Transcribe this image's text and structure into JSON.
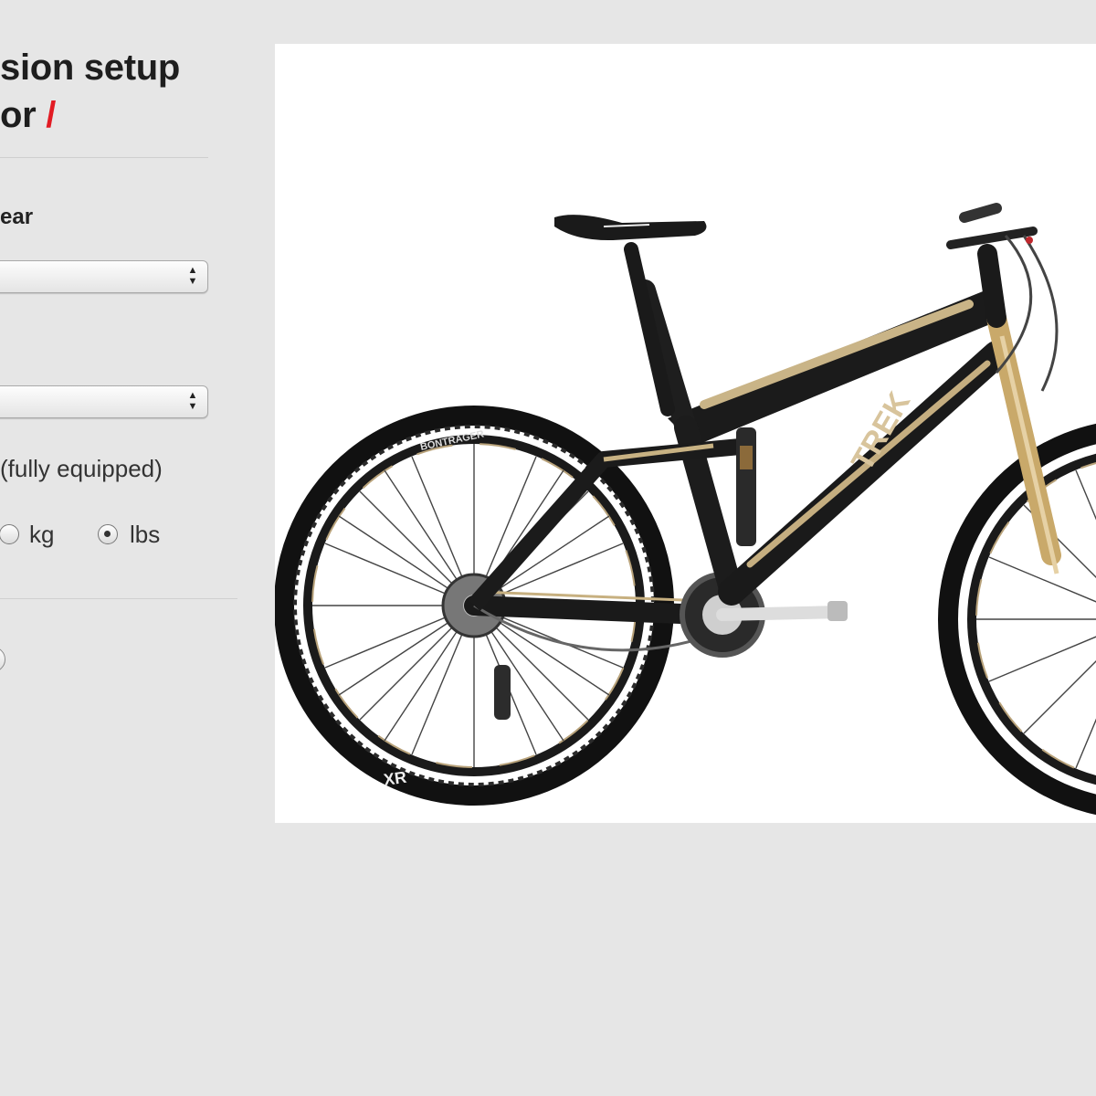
{
  "title": {
    "line1": "sion setup",
    "line2": "or",
    "slash": "/"
  },
  "form": {
    "field1_label": "ear",
    "field3_label": "(fully equipped)",
    "units": {
      "options": [
        "kg",
        "lbs"
      ],
      "selected": "lbs"
    }
  },
  "photo": {
    "brand": "TREK",
    "tire_brand": "BONTRAGER",
    "rim_text": "XR"
  },
  "colors": {
    "accent": "#e21b23",
    "background": "#e6e6e6"
  }
}
